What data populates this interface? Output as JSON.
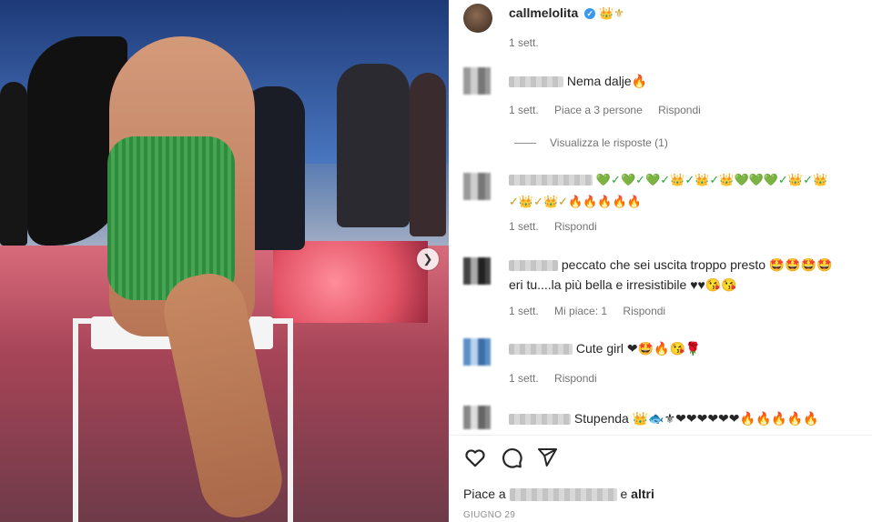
{
  "post": {
    "username": "callmelolita",
    "verified_badge": "verified-check-icon",
    "username_emojis": "👑⚜",
    "time": "1 sett."
  },
  "comments": [
    {
      "text": "Nema dalje🔥",
      "time": "1 sett.",
      "likes": "Piace a 3 persone",
      "reply": "Rispondi",
      "view_replies": "Visualizza le risposte (1)"
    },
    {
      "line1": "💚✓💚✓💚✓👑✓👑✓👑💚💚💚✓👑✓👑",
      "line2": "✓👑✓👑✓🔥🔥🔥🔥🔥",
      "time": "1 sett.",
      "reply": "Rispondi"
    },
    {
      "line1": "peccato che sei uscita troppo presto 🤩🤩🤩🤩",
      "line2": "eri tu....la più bella e irresistibile ♥♥😘😘",
      "time": "1 sett.",
      "likes": "Mi piace: 1",
      "reply": "Rispondi"
    },
    {
      "text": "Cute girl ❤🤩🔥😘🌹",
      "time": "1 sett.",
      "reply": "Rispondi"
    },
    {
      "text": "Stupenda 👑🐟⚜❤❤❤❤❤❤🔥🔥🔥🔥🔥"
    }
  ],
  "actions": {
    "like_icon": "heart-icon",
    "comment_icon": "comment-icon",
    "share_icon": "share-icon"
  },
  "likes_line": {
    "prefix": "Piace a",
    "suffix_and": "e",
    "suffix_others": "altri"
  },
  "date": "GIUGNO 29",
  "colors": {
    "verified": "#3897f0",
    "text": "#262626",
    "muted": "#737373"
  }
}
